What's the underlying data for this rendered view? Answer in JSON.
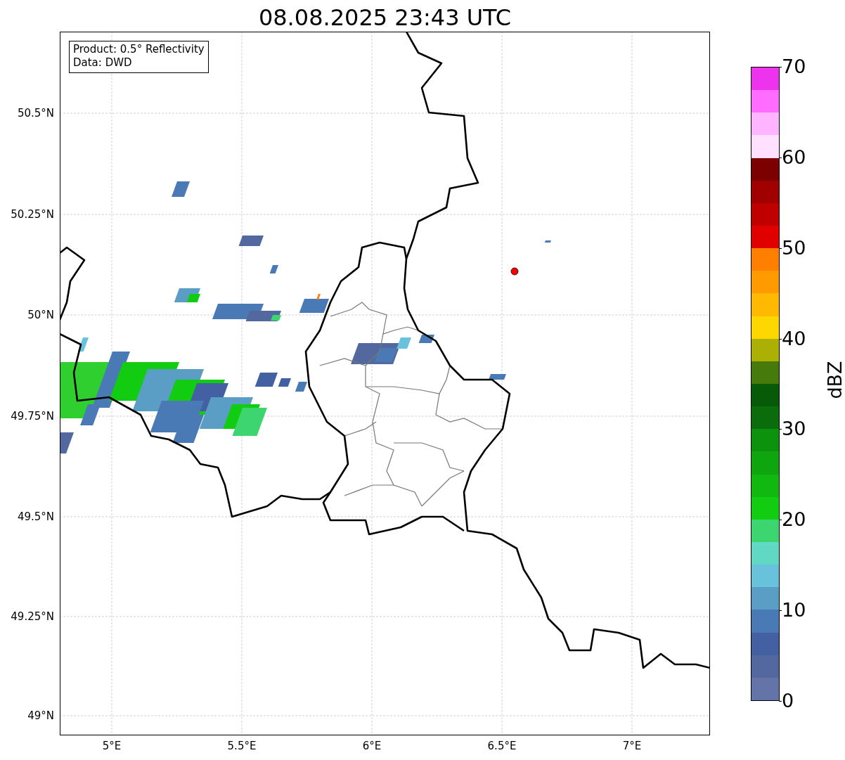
{
  "title": "08.08.2025 23:43 UTC",
  "map": {
    "legend": [
      "Product: 0.5° Reflectivity",
      "Data: DWD"
    ],
    "y_ticks": [
      "50.5°N",
      "50.25°N",
      "50°N",
      "49.75°N",
      "49.5°N",
      "49.25°N",
      "49°N"
    ],
    "x_ticks": [
      "5°E",
      "5.5°E",
      "6°E",
      "6.5°E",
      "7°E"
    ]
  },
  "colorbar": {
    "label": "dBZ",
    "ticks": [
      "70",
      "60",
      "50",
      "40",
      "30",
      "20",
      "10",
      "0"
    ],
    "bands": [
      {
        "color": "#6474a8"
      },
      {
        "color": "#5468a0"
      },
      {
        "color": "#4360a2"
      },
      {
        "color": "#4a7ab5"
      },
      {
        "color": "#5a9ec5"
      },
      {
        "color": "#68c2dc"
      },
      {
        "color": "#60d8c4"
      },
      {
        "color": "#3dd570"
      },
      {
        "color": "#12cc12"
      },
      {
        "color": "#10b810"
      },
      {
        "color": "#0fa50f"
      },
      {
        "color": "#0d920d"
      },
      {
        "color": "#0a6c0a"
      },
      {
        "color": "#075a07"
      },
      {
        "color": "#467a0a"
      },
      {
        "color": "#adb004"
      },
      {
        "color": "#ffd700"
      },
      {
        "color": "#ffb900"
      },
      {
        "color": "#ff9b00"
      },
      {
        "color": "#ff7f00"
      },
      {
        "color": "#e00000"
      },
      {
        "color": "#c00000"
      },
      {
        "color": "#a00000"
      },
      {
        "color": "#7d0000"
      },
      {
        "color": "#ffe0ff"
      },
      {
        "color": "#ffb4ff"
      },
      {
        "color": "#ff6cff"
      },
      {
        "color": "#ee33ee"
      }
    ]
  }
}
